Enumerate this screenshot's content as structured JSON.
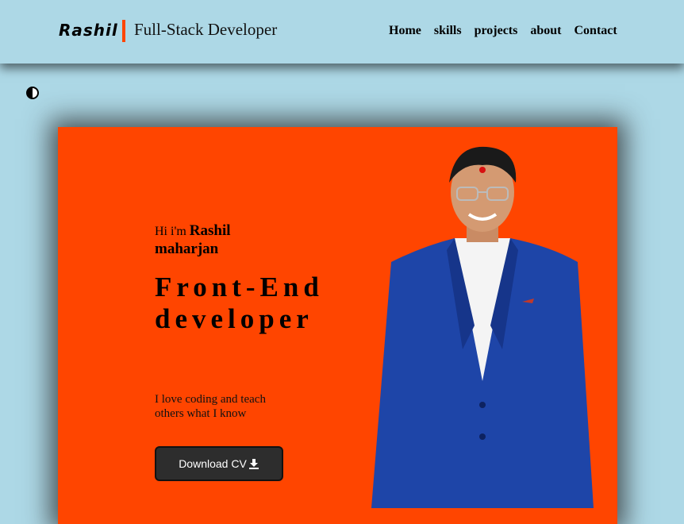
{
  "header": {
    "logo": "Rashil",
    "tagline": "Full-Stack Developer",
    "nav": [
      "Home",
      "skills",
      "projects",
      "about",
      "Contact"
    ]
  },
  "hero": {
    "greeting_prefix": "Hi i'm",
    "name": "Rashil maharjan",
    "role": "Front-End developer",
    "bio": "I love coding and teach others what I know",
    "cv_button": "Download CV"
  },
  "icons": {
    "theme": "contrast-icon",
    "download": "download-icon",
    "portrait": "person-photo"
  },
  "colors": {
    "background": "#add8e6",
    "accent": "#ff4500",
    "button": "#2d2d2d"
  }
}
